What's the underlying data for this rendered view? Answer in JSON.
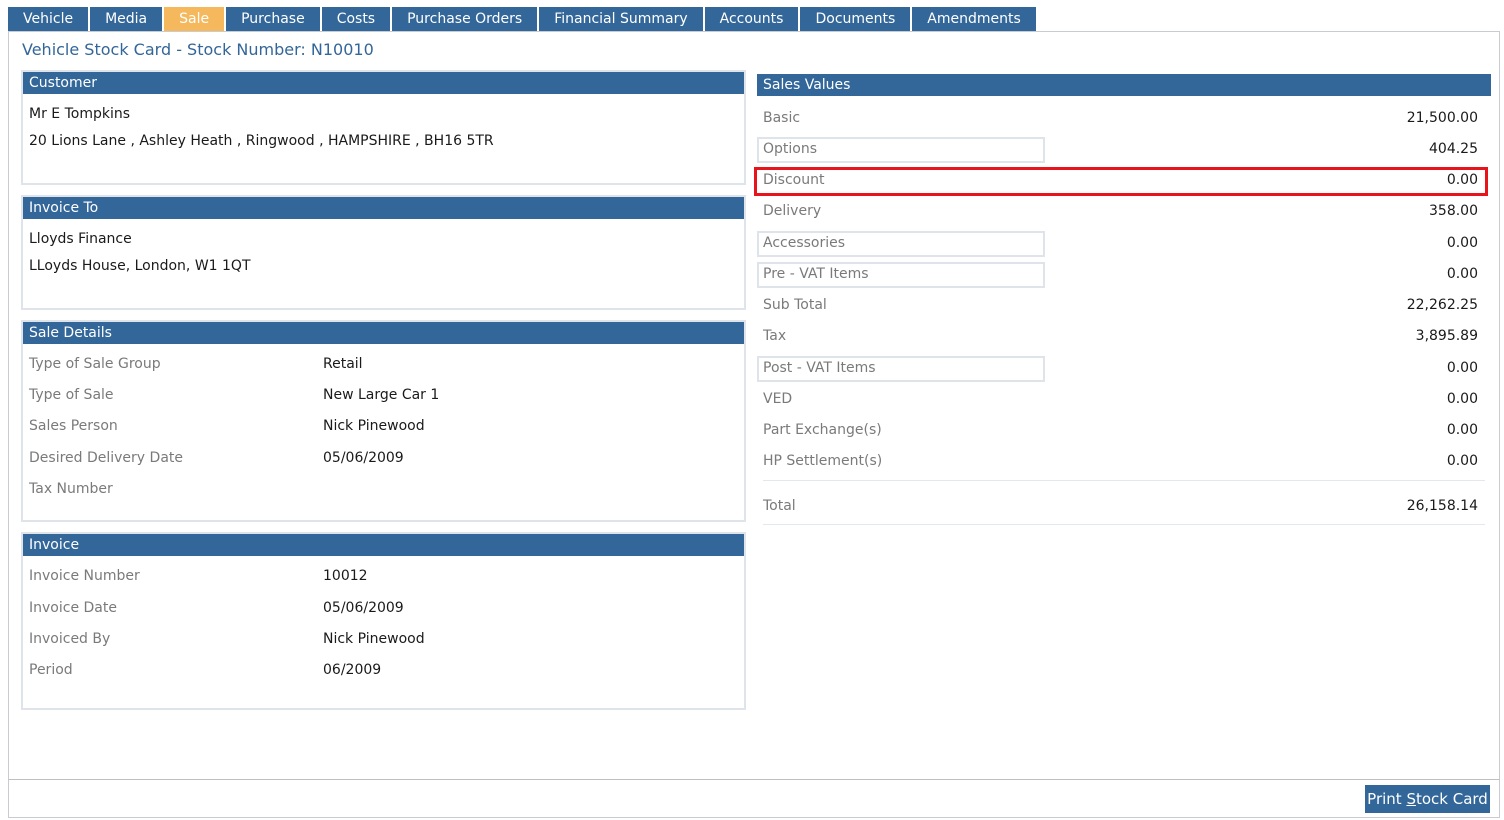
{
  "tabs": [
    {
      "label": "Vehicle"
    },
    {
      "label": "Media"
    },
    {
      "label": "Sale"
    },
    {
      "label": "Purchase"
    },
    {
      "label": "Costs"
    },
    {
      "label": "Purchase Orders"
    },
    {
      "label": "Financial Summary"
    },
    {
      "label": "Accounts"
    },
    {
      "label": "Documents"
    },
    {
      "label": "Amendments"
    }
  ],
  "active_tab": "Sale",
  "page_title": "Vehicle Stock Card - Stock Number: N10010",
  "customer": {
    "heading": "Customer",
    "name": "Mr E Tompkins",
    "address": "20 Lions Lane , Ashley Heath , Ringwood , HAMPSHIRE , BH16 5TR"
  },
  "invoice_to": {
    "heading": "Invoice To",
    "name": "Lloyds Finance",
    "address": "LLoyds House, London, W1 1QT"
  },
  "sale_details": {
    "heading": "Sale Details",
    "rows": [
      {
        "label": "Type of Sale Group",
        "value": "Retail"
      },
      {
        "label": "Type of Sale",
        "value": "New Large Car 1"
      },
      {
        "label": "Sales Person",
        "value": "Nick Pinewood"
      },
      {
        "label": "Desired Delivery Date",
        "value": "05/06/2009"
      },
      {
        "label": "Tax Number",
        "value": ""
      }
    ]
  },
  "invoice": {
    "heading": "Invoice",
    "rows": [
      {
        "label": "Invoice Number",
        "value": "10012"
      },
      {
        "label": "Invoice Date",
        "value": "05/06/2009"
      },
      {
        "label": "Invoiced By",
        "value": "Nick Pinewood"
      },
      {
        "label": "Period",
        "value": "06/2009"
      }
    ]
  },
  "sales_values": {
    "heading": "Sales Values",
    "rows": [
      {
        "label": "Basic",
        "value": "21,500.00"
      },
      {
        "label": "Options",
        "value": "404.25"
      },
      {
        "label": "Discount",
        "value": "0.00"
      },
      {
        "label": "Delivery",
        "value": "358.00"
      },
      {
        "label": "Accessories",
        "value": "0.00"
      },
      {
        "label": "Pre - VAT Items",
        "value": "0.00"
      },
      {
        "label": "Sub Total",
        "value": "22,262.25"
      },
      {
        "label": "Tax",
        "value": "3,895.89"
      },
      {
        "label": "Post - VAT Items",
        "value": "0.00"
      },
      {
        "label": "VED",
        "value": "0.00"
      },
      {
        "label": "Part Exchange(s)",
        "value": "0.00"
      },
      {
        "label": "HP Settlement(s)",
        "value": "0.00"
      }
    ],
    "total_label": "Total",
    "total_value": "26,158.14"
  },
  "print_button": {
    "pre": "Print ",
    "accel": "S",
    "post": "tock Card"
  },
  "colors": {
    "tab": "#336699",
    "active_tab": "#f5b85c",
    "highlight": "#e8141c"
  }
}
